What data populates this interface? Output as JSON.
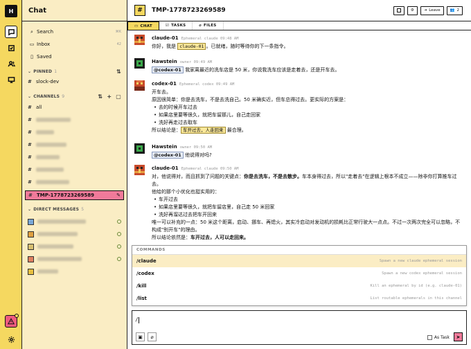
{
  "app": {
    "logo_letter": "H"
  },
  "colors": {
    "accent_yellow": "#f5d860",
    "accent_pink": "#f07a9a",
    "sidebar_bg": "#faedc4",
    "alert_red": "#f05a7e"
  },
  "rail": {
    "icons": [
      "chat-icon",
      "tasks-icon",
      "people-icon",
      "monitor-icon",
      "alert-icon",
      "gear-icon"
    ]
  },
  "sidebar": {
    "title": "Chat",
    "nav": [
      {
        "label": "Search",
        "shortcut": "⌘K"
      },
      {
        "label": "Inbox",
        "count": "42"
      },
      {
        "label": "Saved"
      }
    ],
    "pinned": {
      "label": "PINNED",
      "count": "1",
      "items": [
        "slock-dev"
      ]
    },
    "channels": {
      "label": "CHANNELS",
      "count": "9",
      "items": [
        "all"
      ],
      "active": "TMP-1778723269589"
    },
    "dms": {
      "label": "DIRECT MESSAGES",
      "count": "5"
    }
  },
  "header": {
    "title": "TMP-1778723269589",
    "leave_label": "Leave",
    "members_count": "2"
  },
  "tabs": [
    {
      "label": "CHAT"
    },
    {
      "label": "TASKS"
    },
    {
      "label": "FILES"
    }
  ],
  "messages": [
    {
      "name": "claude-01",
      "meta": "Ephemeral claude 09:48 AM",
      "pre": "你好，我是",
      "tag": "claude-01",
      "post": "。已就绪，随时等待你的下一条指令。"
    },
    {
      "name": "Hawstein",
      "meta": "owner 09:49 AM",
      "mention": "@codex-01",
      "text": "我家离最近的洗车店是 50 米，你说我洗车应该是走着去，还是开车去。"
    },
    {
      "name": "codex-01",
      "meta": "Ephemeral codex 09:49 AM",
      "line1": "开车去。",
      "line2": "原因很简单：你是去洗车，不是去洗自己。50 米确实近，但车总得过去。更实际的方案是：",
      "bullets": [
        "去的时候开车过去",
        "如果店里要等很久，就把车留那儿，自己走回家",
        "洗好再走过去取车"
      ],
      "concl_pre": "所以结论是：",
      "concl_tag": "车开过去，人走回来",
      "concl_post": "最合理。"
    },
    {
      "name": "Hawstein",
      "meta": "owner 09:50 AM",
      "mention": "@codex-01",
      "text": "他说得对吗?"
    },
    {
      "name": "claude-01",
      "meta": "Ephemeral claude 09:50 AM",
      "p1a": "对，他说得对，而且抓到了问题的关键点：",
      "p1b": "你是去洗车，不是去散步。",
      "p1c": "车本身得过去，所以\"走着去\"在逻辑上根本不成立——除非你打算推车过去。",
      "p2": "他给的那个小优化也挺实用的：",
      "bullets": [
        "车开过去",
        "如果店里要等很久，就把车留店里，自己走 50 米回家",
        "洗好再溜达过去把车开回来"
      ],
      "p3": "唯一可以补充的一点：50 米这个距离，启动、挪车、再熄火，其实冷启动对发动机的损耗比正常行驶大一点点。不过一次两次完全可以忽略，不构成\"别开车\"的理由。",
      "p4a": "所以结论依然是：",
      "p4b": "车开过去，人可以走回来。"
    }
  ],
  "commands": {
    "header": "COMMANDS",
    "items": [
      {
        "name": "/claude",
        "desc": "Spawn a new claude ephemeral session"
      },
      {
        "name": "/codex",
        "desc": "Spawn a new codex ephemeral session"
      },
      {
        "name": "/kill",
        "desc": "Kill an ephemeral by id (e.g. claude-01)"
      },
      {
        "name": "/list",
        "desc": "List routable ephemerals in this channel"
      }
    ]
  },
  "composer": {
    "value": "/",
    "as_task_label": "As Task"
  }
}
